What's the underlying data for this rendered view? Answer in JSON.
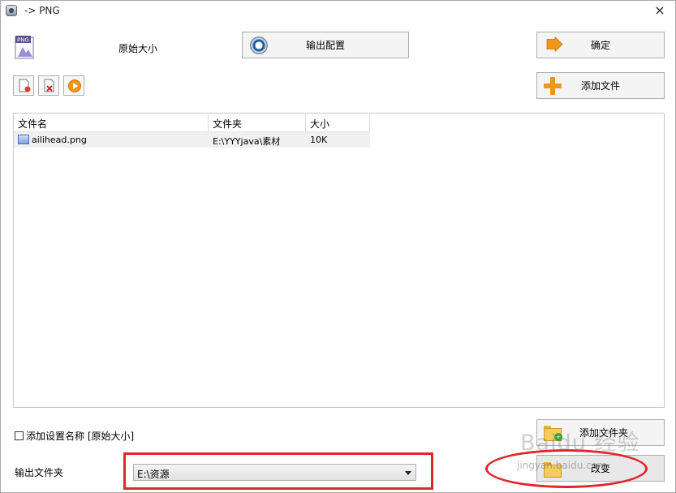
{
  "window": {
    "title": "-> PNG",
    "close_label": "×"
  },
  "header": {
    "format_icon_label": "PNG",
    "original_size_label": "原始大小",
    "output_config_label": "输出配置",
    "ok_label": "确定",
    "add_file_label": "添加文件"
  },
  "file_list": {
    "columns": [
      "文件名",
      "文件夹",
      "大小"
    ],
    "rows": [
      {
        "name": "ailihead.png",
        "folder": "E:\\YYYjava\\素材",
        "size": "10K"
      }
    ]
  },
  "options": {
    "add_setting_name_label": "添加设置名称 [原始大小]",
    "add_folder_label": "添加文件夹",
    "output_folder_label": "输出文件夹",
    "output_folder_value": "E:\\资源",
    "change_label": "改变"
  },
  "watermark": {
    "text": "Baidu 经验",
    "url_text": "jingyan.baidu.com"
  },
  "colors": {
    "highlight": "#e0262b",
    "accent_orange": "#f0961b"
  }
}
